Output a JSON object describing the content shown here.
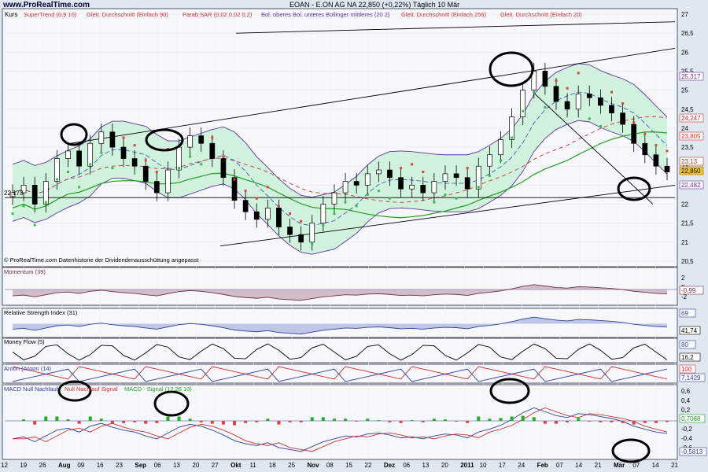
{
  "header": {
    "brand": "www.ProRealTime.com",
    "title": "EOAN - E.ON AG NA   22,850 (+0,22%)   Täglich  10 Mär"
  },
  "main_panel": {
    "label": "Kurs",
    "legend": [
      {
        "text": "SuperTrend (0,9 10)",
        "color": "#d03030"
      },
      {
        "text": "Gleit. Durchschnitt (Einfach 90)",
        "color": "#d03030"
      },
      {
        "text": "Parab SAR (0,02 0,02 0,2)",
        "color": "#d03030"
      },
      {
        "text": "Bol. oberes Bol. unteres Bollinger mittleres (20 2)",
        "color": "#6030a0"
      },
      {
        "text": "Gleit. Durchschnitt (Einfach 256)",
        "color": "#d03030"
      },
      {
        "text": "Gleit. Durchschnitt (Einfach 20)",
        "color": "#d03030"
      }
    ],
    "level_label": "22,173",
    "footer": "© ProRealTime.com  Datenhistorie der Dividendenausschüttung angepasst",
    "price_tags": [
      {
        "text": "25,317",
        "color": "#7030a0"
      },
      {
        "text": "24,247",
        "color": "#d03030"
      },
      {
        "text": "23,805",
        "color": "#d03030"
      },
      {
        "text": "23,13",
        "color": "#d03030"
      },
      {
        "text": "22,850",
        "color": "#000000"
      },
      {
        "text": "22,482",
        "color": "#7030a0"
      }
    ]
  },
  "momentum_panel": {
    "label": "Momentum (39)",
    "value_tag": "-0,99"
  },
  "rsi_panel": {
    "label": "Relative Strength Index (31)",
    "value_tags": [
      "69",
      "41,74"
    ]
  },
  "mfi_panel": {
    "label": "Money Flow (5)",
    "value_tags": [
      "80",
      "16,2"
    ]
  },
  "aroon_panel": {
    "label": "Aroon (Aroon (14)",
    "value_tags": [
      "100",
      "7,1429"
    ]
  },
  "macd_panel": {
    "label_1": "MACD Null Nachlauf",
    "label_2": "Null Nachlauf Signal",
    "label_3": "MACD - Signal (12 26 10)",
    "value_tags": [
      "0,7068",
      "-0,5813"
    ]
  },
  "chart_data": {
    "type": "candlestick",
    "ylim": [
      20.5,
      27
    ],
    "y_ticks": [
      "27",
      "26,5",
      "26",
      "25,5",
      "25",
      "24,5",
      "24",
      "23,5",
      "23",
      "22,5",
      "22",
      "21,5",
      "21",
      "20,5"
    ],
    "momentum_ticks": [
      "2",
      "0",
      "-2"
    ],
    "macd_ticks": [
      "0,6",
      "0,4",
      "0,2",
      "0",
      "-0,2",
      "-0,4",
      "-0,6"
    ],
    "x_labels": [
      "12",
      "19",
      "26",
      "Aug",
      "09",
      "16",
      "23",
      "Sep",
      "06",
      "13",
      "20",
      "27",
      "Okt",
      "11",
      "18",
      "25",
      "Nov",
      "08",
      "15",
      "22",
      "Dez",
      "06",
      "13",
      "20",
      "2011",
      "10",
      "17",
      "24",
      "Feb",
      "07",
      "14",
      "21",
      "Mär",
      "07",
      "14",
      "21"
    ],
    "close_series": [
      22.3,
      22.5,
      22.0,
      22.6,
      23.2,
      23.4,
      23.0,
      23.6,
      23.9,
      23.5,
      23.2,
      23.0,
      22.6,
      22.3,
      22.9,
      23.5,
      23.8,
      23.6,
      23.2,
      22.7,
      22.1,
      21.8,
      21.6,
      21.9,
      21.4,
      21.2,
      21.0,
      21.5,
      22.0,
      22.3,
      22.6,
      22.5,
      22.8,
      22.9,
      22.7,
      22.4,
      22.5,
      22.3,
      22.6,
      22.8,
      22.7,
      22.4,
      23.0,
      23.3,
      23.7,
      24.3,
      25.0,
      25.5,
      25.1,
      24.7,
      24.5,
      24.9,
      24.8,
      24.6,
      24.4,
      24.1,
      23.6,
      23.3,
      23.0,
      22.85
    ],
    "ellipse_marks": 7
  }
}
